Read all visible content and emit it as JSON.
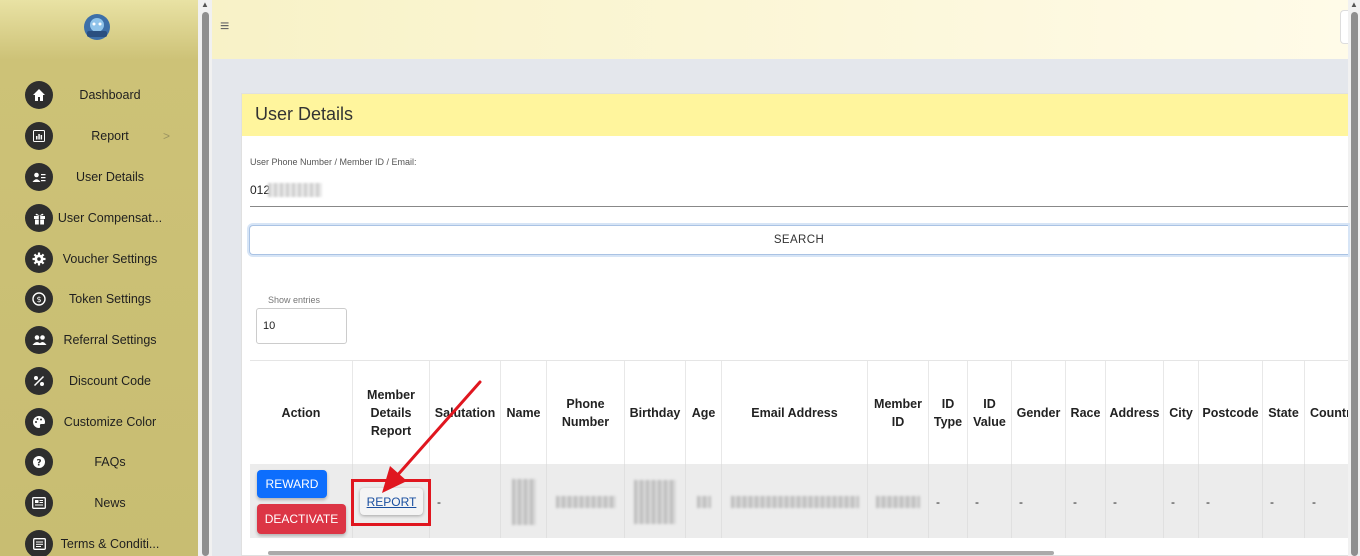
{
  "sidebar": {
    "items": [
      {
        "label": "Dashboard",
        "icon": "home-icon"
      },
      {
        "label": "Report",
        "icon": "chart-icon",
        "has_chevron": true
      },
      {
        "label": "User Details",
        "icon": "user-card-icon"
      },
      {
        "label": "User Compensat...",
        "icon": "gift-icon"
      },
      {
        "label": "Voucher Settings",
        "icon": "gear-icon"
      },
      {
        "label": "Token Settings",
        "icon": "coin-icon"
      },
      {
        "label": "Referral Settings",
        "icon": "users-icon"
      },
      {
        "label": "Discount Code",
        "icon": "percent-icon"
      },
      {
        "label": "Customize Color",
        "icon": "palette-icon"
      },
      {
        "label": "FAQs",
        "icon": "question-icon"
      },
      {
        "label": "News",
        "icon": "newspaper-icon"
      },
      {
        "label": "Terms & Conditi...",
        "icon": "document-icon"
      }
    ],
    "chevron": ">"
  },
  "topbar": {
    "menu_glyph": "≡"
  },
  "card": {
    "title": "User Details",
    "field_label": "User Phone Number / Member ID / Email:",
    "field_value": "012",
    "search_label": "SEARCH",
    "entries_label": "Show entries",
    "entries_value": "10"
  },
  "table": {
    "headers": [
      "Action",
      "Member Details Report",
      "Salutation",
      "Name",
      "Phone Number",
      "Birthday",
      "Age",
      "Email Address",
      "Member ID",
      "ID Type",
      "ID Value",
      "Gender",
      "Race",
      "Address",
      "City",
      "Postcode",
      "State",
      "Countr"
    ],
    "row": {
      "reward_label": "REWARD",
      "deactivate_label": "DEACTIVATE",
      "report_label": "REPORT",
      "salutation": "-",
      "id_type": "-",
      "id_value": "-",
      "gender": "-",
      "race": "-",
      "address": "-",
      "city": "-",
      "postcode": "-",
      "state": "-",
      "country": "-"
    }
  },
  "colors": {
    "sidebar": "#cdc277",
    "header": "#fff59d",
    "reward": "#0d6efd",
    "deactivate": "#dc3545",
    "annotation": "#e0161f"
  }
}
